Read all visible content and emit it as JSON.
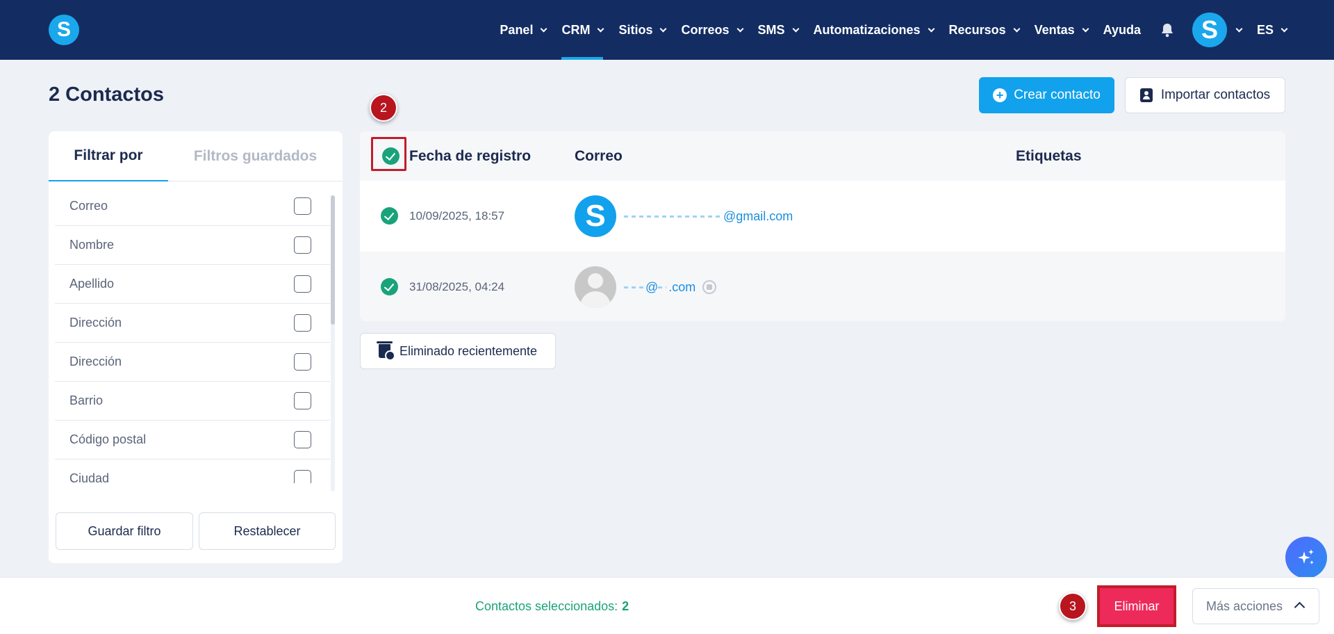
{
  "app": {
    "logo_letter": "S",
    "nav": [
      {
        "label": "Panel",
        "has_menu": true
      },
      {
        "label": "CRM",
        "has_menu": true,
        "active": true
      },
      {
        "label": "Sitios",
        "has_menu": true
      },
      {
        "label": "Correos",
        "has_menu": true
      },
      {
        "label": "SMS",
        "has_menu": true
      },
      {
        "label": "Automatizaciones",
        "has_menu": true
      },
      {
        "label": "Recursos",
        "has_menu": true
      },
      {
        "label": "Ventas",
        "has_menu": true
      },
      {
        "label": "Ayuda",
        "has_menu": false
      }
    ],
    "user_avatar_letter": "S",
    "language": "ES"
  },
  "page": {
    "title": "2 Contactos",
    "create_button": "Crear contacto",
    "import_button": "Importar contactos",
    "recently_deleted_button": "Eliminado recientemente"
  },
  "filters": {
    "tabs": [
      "Filtrar por",
      "Filtros guardados"
    ],
    "active_tab": "Filtrar por",
    "items": [
      "Correo",
      "Nombre",
      "Apellido",
      "Dirección",
      "Dirección",
      "Barrio",
      "Código postal",
      "Ciudad"
    ],
    "save_button": "Guardar filtro",
    "reset_button": "Restablecer"
  },
  "table": {
    "columns": [
      "Fecha de registro",
      "Correo",
      "Etiquetas"
    ],
    "header_checked": true,
    "rows": [
      {
        "checked": true,
        "date": "10/09/2025, 18:57",
        "avatar": "S",
        "email_visible": "@gmail.com"
      },
      {
        "checked": true,
        "date": "31/08/2025, 04:24",
        "avatar": "default",
        "email_visible_a": "@",
        "email_visible_b": ".com"
      }
    ]
  },
  "bottom": {
    "selected_label": "Contactos seleccionados:",
    "selected_count": "2",
    "delete_button": "Eliminar",
    "more_actions_button": "Más acciones"
  },
  "annotations": {
    "step_2": "2",
    "step_3": "3"
  },
  "colors": {
    "nav_bg": "#132d63",
    "accent": "#12a1ec",
    "success": "#1aa37a",
    "danger": "#ee2a5a",
    "highlight": "#c21d2b"
  }
}
